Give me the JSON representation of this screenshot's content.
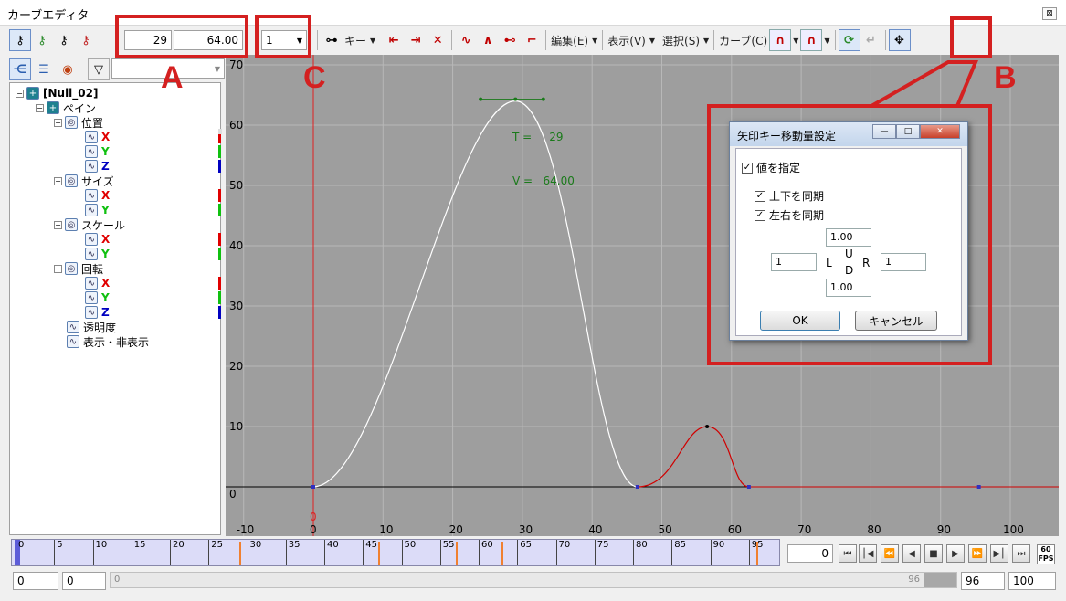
{
  "window": {
    "title": "カーブエディタ",
    "close": "⊠"
  },
  "toolbar": {
    "time_value": "29",
    "value_value": "64.00",
    "step_value": "1",
    "key_menu": "キー",
    "edit_menu": "編集(E)",
    "view_menu": "表示(V)",
    "select_menu": "選択(S)",
    "curve_menu": "カーブ(C)"
  },
  "tree": {
    "root": "[Null_02]",
    "layer": "ペイン",
    "groups": [
      {
        "label": "位置",
        "channels": [
          "X",
          "Y",
          "Z"
        ]
      },
      {
        "label": "サイズ",
        "channels": [
          "X",
          "Y"
        ]
      },
      {
        "label": "スケール",
        "channels": [
          "X",
          "Y"
        ]
      },
      {
        "label": "回転",
        "channels": [
          "X",
          "Y",
          "Z"
        ]
      }
    ],
    "opacity": "透明度",
    "visibility": "表示・非表示"
  },
  "graph": {
    "y_ticks": [
      "70",
      "60",
      "50",
      "40",
      "30",
      "20",
      "10",
      "0"
    ],
    "x_ticks": [
      "-10",
      "0",
      "10",
      "20",
      "30",
      "40",
      "50",
      "60",
      "70",
      "80",
      "90",
      "100"
    ],
    "current_frame_label": "0",
    "readout_t": "T =     29",
    "readout_v": "V =   64.00",
    "curve_color": "#ffffff",
    "active_segment_color": "#d00000"
  },
  "timeline": {
    "ticks": [
      "0",
      "5",
      "10",
      "15",
      "20",
      "25",
      "30",
      "35",
      "40",
      "45",
      "50",
      "55",
      "60",
      "65",
      "70",
      "75",
      "80",
      "85",
      "90",
      "95"
    ],
    "keyframes": [
      29,
      47,
      57,
      63,
      96
    ],
    "frame_value": "0",
    "fps": "60 FPS"
  },
  "bottom": {
    "start_a": "0",
    "start_b": "0",
    "scroll_left": "0",
    "scroll_right": "96",
    "end_value": "96",
    "total_value": "100"
  },
  "dialog": {
    "title": "矢印キー移動量設定",
    "specify_value": "値を指定",
    "sync_updown": "上下を同期",
    "sync_leftright": "左右を同期",
    "up_value": "1.00",
    "down_value": "1.00",
    "left_value": "1",
    "right_value": "1",
    "label_u": "U",
    "label_d": "D",
    "label_l": "L",
    "label_r": "R",
    "ok": "OK",
    "cancel": "キャンセル",
    "min_btn": "—",
    "max_btn": "□",
    "close_btn": "✕"
  },
  "annotations": {
    "a": "A",
    "b": "B",
    "c": "C",
    "color": "#d42020"
  }
}
